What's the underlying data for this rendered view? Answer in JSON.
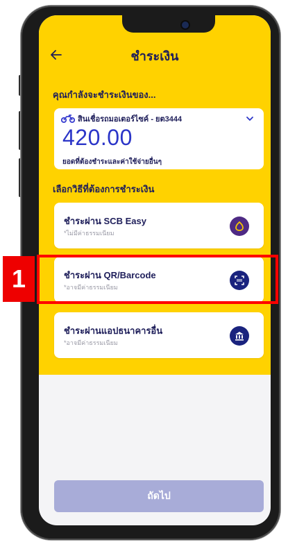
{
  "header": {
    "title": "ชำระเงิน",
    "back_icon": "back-arrow-icon"
  },
  "paying_for_label": "คุณกำลังจะชำระเงินของ...",
  "account": {
    "icon": "motorcycle-icon",
    "name": "สินเชื่อรถมอเตอร์ไซค์ - ยต3444",
    "amount": "420.00",
    "note": "ยอดที่ต้องชำระและค่าใช้จ่ายอื่นๆ"
  },
  "choose_method_label": "เลือกวิธีที่ต้องการชำระเงิน",
  "payment_options": [
    {
      "title": "ชำระผ่าน SCB Easy",
      "subtitle": "*ไม่มีค่าธรรมเนียม",
      "icon": "scb-logo-icon",
      "icon_color": "#4e2a84"
    },
    {
      "title": "ชำระผ่าน QR/Barcode",
      "subtitle": "*อาจมีค่าธรรมเนียม",
      "icon": "qr-scan-icon",
      "icon_color": "#1a237e"
    },
    {
      "title": "ชำระผ่านแอปธนาคารอื่น",
      "subtitle": "*อาจมีค่าธรรมเนียม",
      "icon": "bank-icon",
      "icon_color": "#1a237e"
    }
  ],
  "next_button": "ถัดไป",
  "annotation": {
    "step_number": "1",
    "color": "#ff0000"
  },
  "colors": {
    "header_bg": "#ffd200",
    "text_navy": "#1e1e5a",
    "amount_blue": "#2b35c8",
    "button_disabled": "#a8acd8"
  }
}
